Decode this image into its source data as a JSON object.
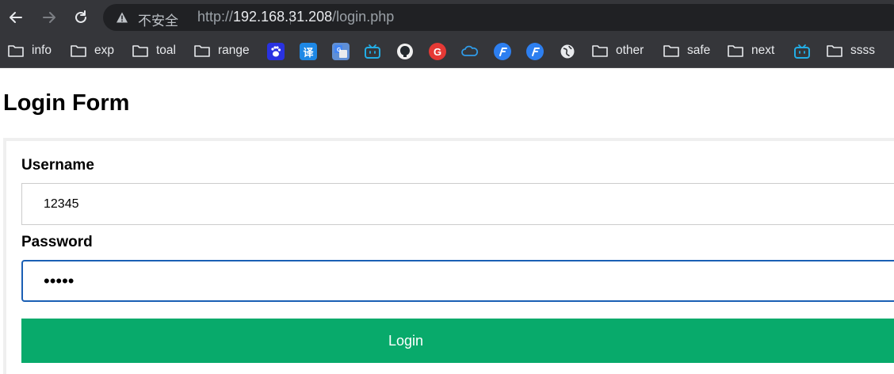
{
  "browser": {
    "insecure_label": "不安全",
    "url_prefix": "http://",
    "url_host": "192.168.31.208",
    "url_path": "/login.php"
  },
  "bookmarks": {
    "folders": [
      "info",
      "exp",
      "toal",
      "range",
      "other",
      "safe",
      "next",
      "ssss"
    ],
    "icons": [
      "baidu-paw-icon",
      "translate-icon",
      "google-translate-icon",
      "bilibili-tv-icon",
      "github-octocat-icon",
      "red-g-icon",
      "cloud-icon",
      "blue-f-icon",
      "blue-f-icon",
      "globe-icon",
      "bilibili-tv-icon"
    ],
    "translate_glyph": "译",
    "g_glyph": "G"
  },
  "page": {
    "title": "Login Form",
    "username_label": "Username",
    "username_value": "12345",
    "password_label": "Password",
    "password_value": "•••••",
    "login_label": "Login"
  },
  "colors": {
    "toolbar_bg": "#35363a",
    "omnibox_bg": "#202124",
    "login_button": "#08aa6b",
    "focus_border": "#1a5fb4"
  }
}
